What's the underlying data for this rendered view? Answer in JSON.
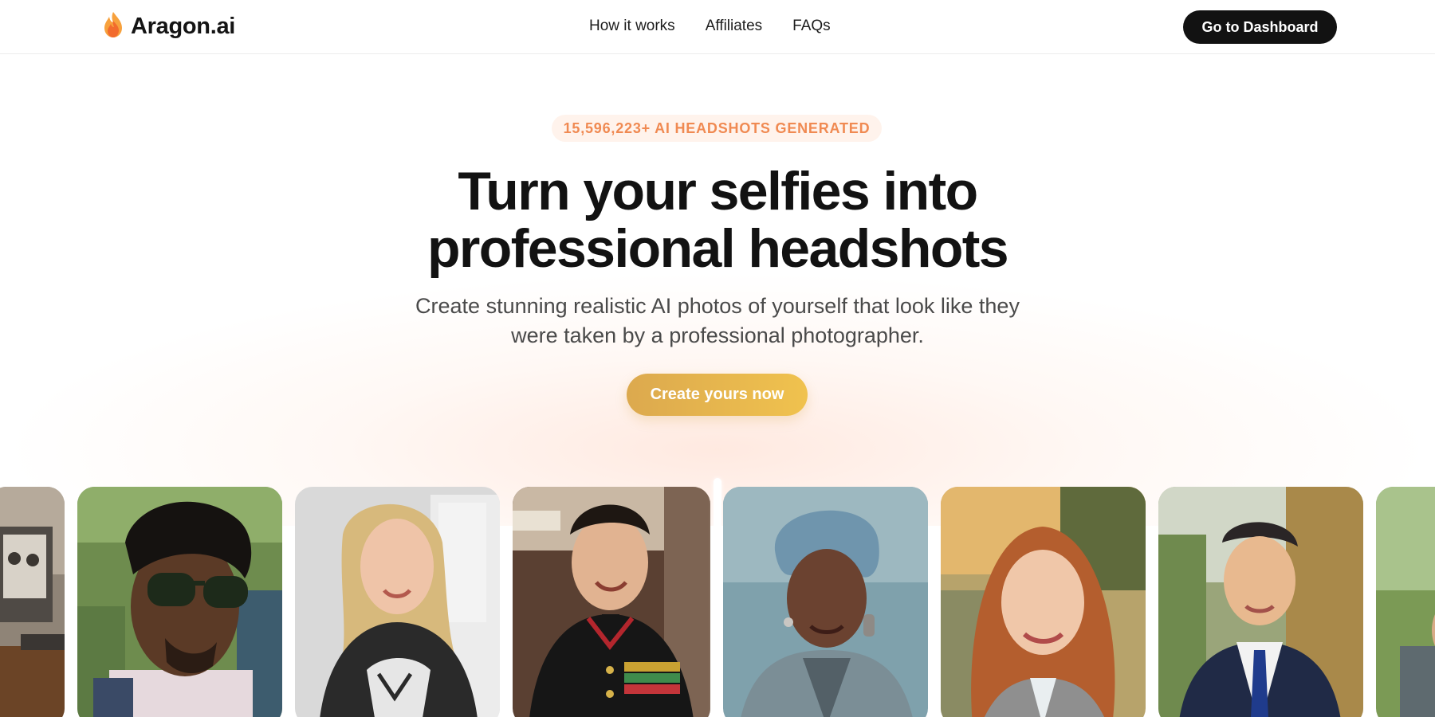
{
  "brand": {
    "name": "Aragon.ai",
    "logo_icon": "flame-icon",
    "logo_colors": [
      "#f7a13d",
      "#f26b2d"
    ]
  },
  "nav": {
    "links": [
      "How it works",
      "Affiliates",
      "FAQs"
    ],
    "dashboard_button": "Go to Dashboard"
  },
  "hero": {
    "badge": "15,596,223+ AI HEADSHOTS GENERATED",
    "headline_line1": "Turn your selfies into",
    "headline_line2": "professional headshots",
    "subtext_line1": "Create stunning realistic AI photos of yourself that look like they",
    "subtext_line2": "were taken by a professional photographer.",
    "cta": "Create yours now"
  },
  "colors": {
    "badge_text": "#f08a52",
    "badge_bg": "#fff3ec",
    "cta_gradient": [
      "#dca94e",
      "#f0c24e"
    ],
    "dashboard_button_bg": "#121212"
  },
  "gallery": {
    "photos": [
      "photo-vintage-crop",
      "photo-man-sunglasses-selfie",
      "photo-blonde-woman-selfie",
      "photo-marine-uniform-selfie",
      "photo-woman-blue-headwrap-headshot",
      "photo-redhead-woman-headshot",
      "photo-man-suit-tie-headshot",
      "photo-partial-crop"
    ]
  }
}
